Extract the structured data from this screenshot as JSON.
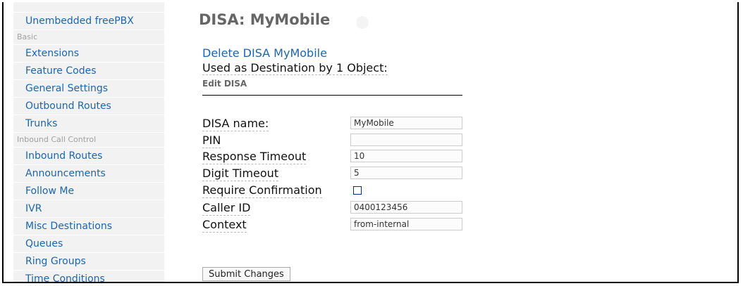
{
  "sidebar": {
    "items": [
      {
        "kind": "item",
        "label": "Unembedded freePBX"
      },
      {
        "kind": "section",
        "label": "Basic"
      },
      {
        "kind": "item",
        "label": "Extensions"
      },
      {
        "kind": "item",
        "label": "Feature Codes"
      },
      {
        "kind": "item",
        "label": "General Settings"
      },
      {
        "kind": "item",
        "label": "Outbound Routes"
      },
      {
        "kind": "item",
        "label": "Trunks"
      },
      {
        "kind": "section",
        "label": "Inbound Call Control"
      },
      {
        "kind": "item",
        "label": "Inbound Routes"
      },
      {
        "kind": "item",
        "label": "Announcements"
      },
      {
        "kind": "item",
        "label": "Follow Me"
      },
      {
        "kind": "item",
        "label": "IVR"
      },
      {
        "kind": "item",
        "label": "Misc Destinations"
      },
      {
        "kind": "item",
        "label": "Queues"
      },
      {
        "kind": "item",
        "label": "Ring Groups"
      },
      {
        "kind": "item",
        "label": "Time Conditions"
      }
    ]
  },
  "main": {
    "title": "DISA: MyMobile",
    "delete_link": "Delete DISA MyMobile",
    "used_as": "Used as Destination by 1 Object:",
    "section_header": "Edit DISA",
    "form": {
      "disa_name": {
        "label": "DISA name:",
        "value": "MyMobile"
      },
      "pin": {
        "label": "PIN",
        "value": ""
      },
      "response_timeout": {
        "label": "Response Timeout",
        "value": "10"
      },
      "digit_timeout": {
        "label": "Digit Timeout",
        "value": "5"
      },
      "require_confirmation": {
        "label": "Require Confirmation",
        "checked": false
      },
      "caller_id": {
        "label": "Caller ID",
        "value": "0400123456"
      },
      "context": {
        "label": "Context",
        "value": "from-internal"
      }
    },
    "submit_label": "Submit Changes"
  }
}
